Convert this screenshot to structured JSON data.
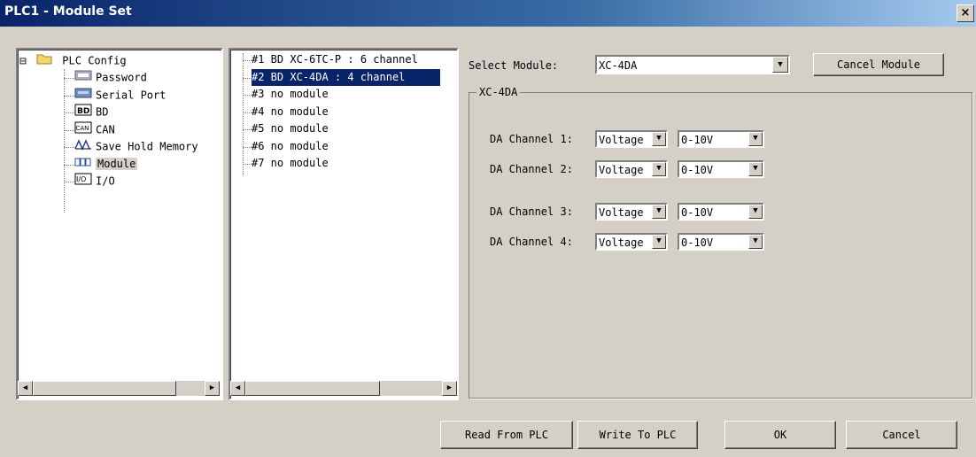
{
  "window": {
    "title": "PLC1 - Module Set",
    "close_label": "×"
  },
  "tree": {
    "root_label": "PLC Config",
    "expand_glyph": "⊟",
    "items": [
      {
        "label": "Password",
        "icon": "password-icon"
      },
      {
        "label": "Serial Port",
        "icon": "serial-port-icon"
      },
      {
        "label": "BD",
        "icon": "bd-icon"
      },
      {
        "label": "CAN",
        "icon": "can-icon"
      },
      {
        "label": "Save Hold Memory",
        "icon": "save-hold-memory-icon"
      },
      {
        "label": "Module",
        "icon": "module-icon",
        "selected": true
      },
      {
        "label": "I/O",
        "icon": "io-icon"
      }
    ]
  },
  "slots": {
    "items": [
      {
        "label": "#1 BD XC-6TC-P : 6 channel"
      },
      {
        "label": "#2 BD XC-4DA : 4 channel",
        "selected": true
      },
      {
        "label": "#3 no module"
      },
      {
        "label": "#4 no module"
      },
      {
        "label": "#5 no module"
      },
      {
        "label": "#6 no module"
      },
      {
        "label": "#7 no module"
      }
    ]
  },
  "module": {
    "select_label": "Select Module:",
    "selected_module": "XC-4DA",
    "cancel_module_label": "Cancel Module",
    "group_title": "XC-4DA",
    "channels": [
      {
        "label": "DA Channel 1:",
        "mode": "Voltage",
        "range": "0-10V"
      },
      {
        "label": "DA Channel 2:",
        "mode": "Voltage",
        "range": "0-10V"
      },
      {
        "label": "DA Channel 3:",
        "mode": "Voltage",
        "range": "0-10V"
      },
      {
        "label": "DA Channel 4:",
        "mode": "Voltage",
        "range": "0-10V"
      }
    ]
  },
  "footer": {
    "read_label": "Read From PLC",
    "write_label": "Write To PLC",
    "ok_label": "OK",
    "cancel_label": "Cancel"
  }
}
